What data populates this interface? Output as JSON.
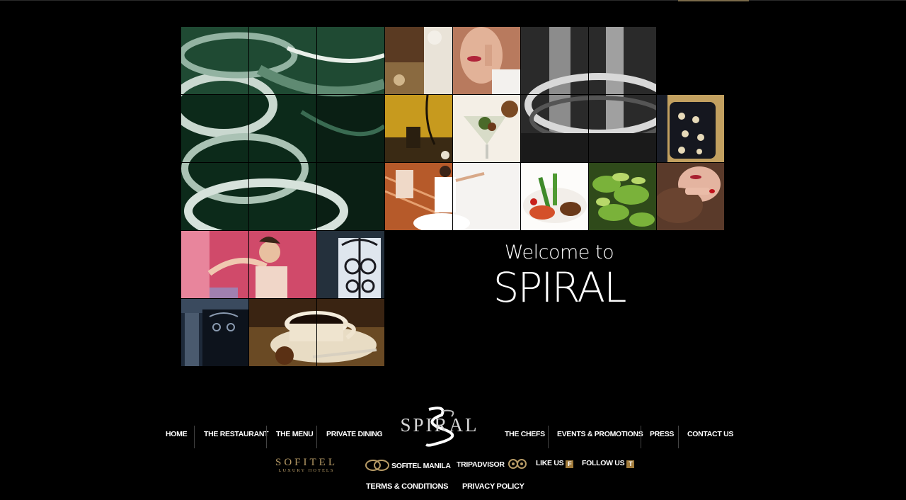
{
  "welcome": {
    "line1": "Welcome to",
    "line2": "SPIRAL"
  },
  "logo": {
    "text": "SPIRAL"
  },
  "nav": {
    "home": "HOME",
    "restaurant": "THE RESTAURANT",
    "menu": "THE MENU",
    "private_dining": "PRIVATE DINING",
    "chefs": "THE CHEFS",
    "events": "EVENTS & PROMOTIONS",
    "press": "PRESS",
    "contact": "CONTACT US"
  },
  "footer": {
    "sofitel_brand": "SOFITEL",
    "sofitel_sub": "LUXURY HOTELS",
    "sofitel_manila": "SOFITEL MANILA",
    "tripadvisor": "TRIPADVISOR",
    "like_us": "LIKE US",
    "follow_us": "FOLLOW US",
    "facebook_glyph": "f",
    "twitter_glyph": "t",
    "terms": "TERMS & CONDITIONS",
    "privacy": "PRIVACY POLICY"
  },
  "colors": {
    "background": "#000000",
    "gold": "#b79b66",
    "text": "#ffffff"
  }
}
